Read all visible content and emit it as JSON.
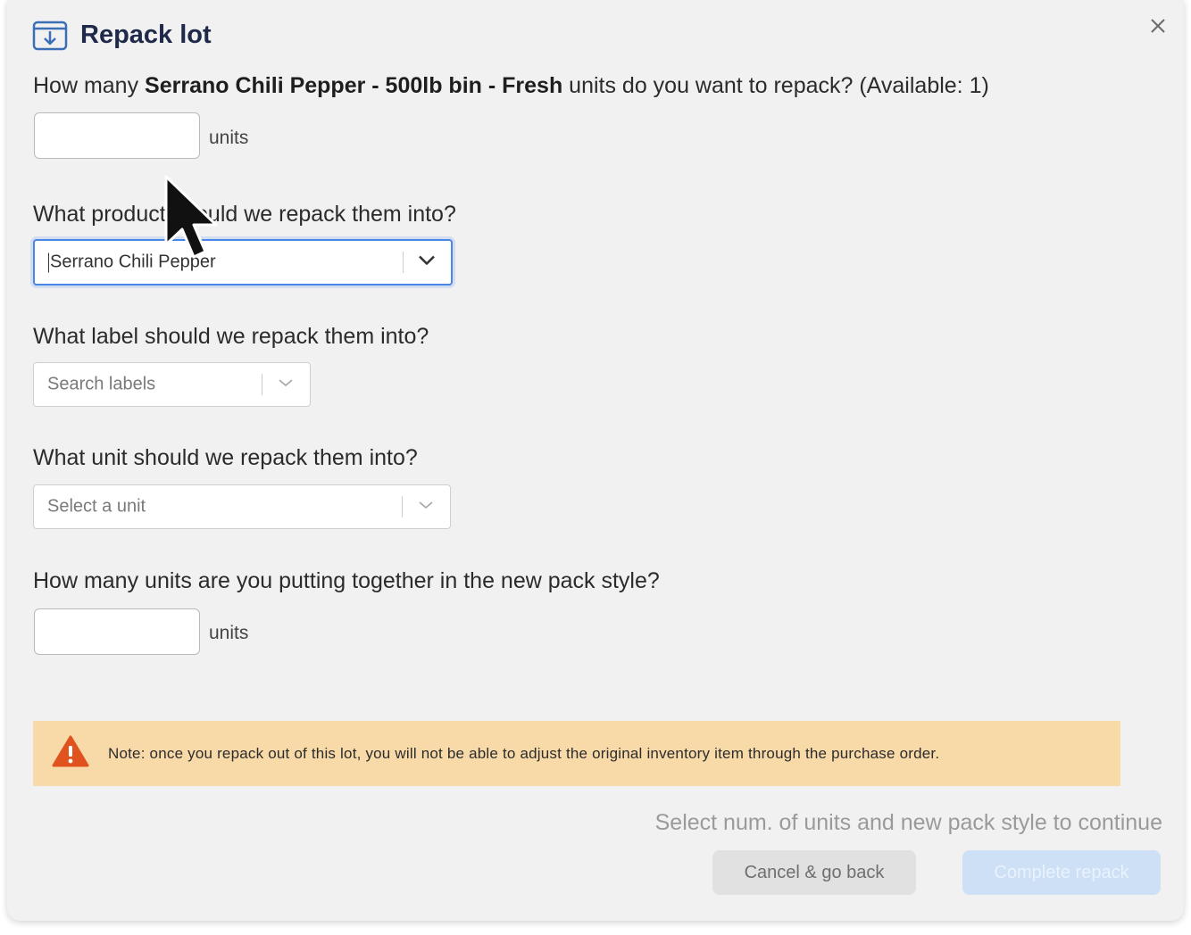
{
  "dialog": {
    "title": "Repack lot",
    "title_icon": "repack-box-icon",
    "close_icon": "close-icon"
  },
  "quantity_question": {
    "prefix": "How many ",
    "product_bold": "Serrano Chili Pepper - 500lb bin - Fresh",
    "suffix": " units do you want to repack? (Available: 1)"
  },
  "quantity_input": {
    "value": "",
    "unit_label": "units"
  },
  "product_question": "What product should we repack them into?",
  "product_select": {
    "value": "Serrano Chili Pepper",
    "icon": "chevron-down-icon"
  },
  "label_question": "What label should we repack them into?",
  "label_select": {
    "placeholder": "Search labels",
    "icon": "chevron-down-icon"
  },
  "unit_question": "What unit should we repack them into?",
  "unit_select": {
    "placeholder": "Select a unit",
    "icon": "chevron-down-icon"
  },
  "pack_question": "How many units are you putting together in the new pack style?",
  "pack_input": {
    "value": "",
    "unit_label": "units"
  },
  "warning": {
    "icon": "warning-triangle-icon",
    "text": "Note: once you repack out of this lot, you will not be able to adjust the original inventory item through the purchase order."
  },
  "footer": {
    "hint": "Select num. of units and new pack style to continue",
    "cancel_label": "Cancel & go back",
    "complete_label": "Complete repack"
  },
  "colors": {
    "title": "#1f2a4a",
    "focus_border": "#4a86e8",
    "warning_bg": "#f8d9a8",
    "warning_icon": "#e0531f",
    "complete_bg": "#cde0f6"
  }
}
